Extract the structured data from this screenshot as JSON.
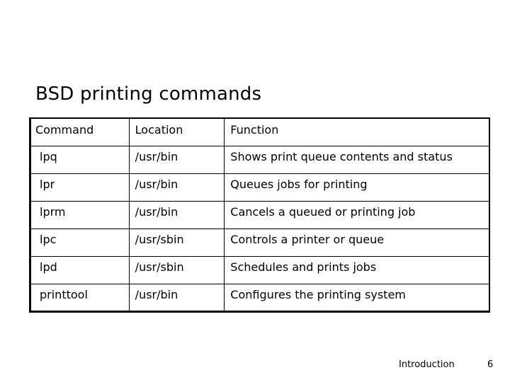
{
  "slide": {
    "title": "BSD printing commands",
    "footer_label": "Introduction",
    "page_number": "6"
  },
  "table": {
    "headers": [
      "Command",
      "Location",
      "Function"
    ],
    "rows": [
      [
        "lpq",
        "/usr/bin",
        "Shows print queue contents and status"
      ],
      [
        "lpr",
        "/usr/bin",
        "Queues jobs for printing"
      ],
      [
        "lprm",
        "/usr/bin",
        "Cancels a queued or printing job"
      ],
      [
        "lpc",
        "/usr/sbin",
        "Controls a printer or queue"
      ],
      [
        "lpd",
        "/usr/sbin",
        "Schedules and prints jobs"
      ],
      [
        "printtool",
        "/usr/bin",
        "Configures the printing system"
      ]
    ]
  }
}
